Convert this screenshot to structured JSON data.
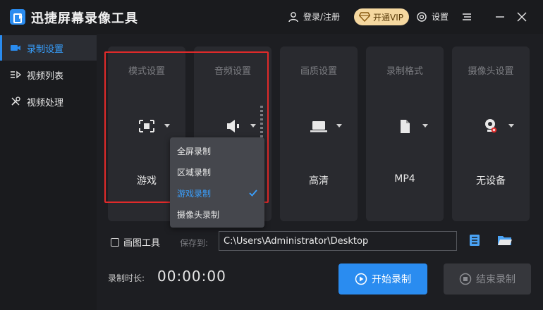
{
  "app": {
    "title": "迅捷屏幕录像工具"
  },
  "header": {
    "login_label": "登录/注册",
    "vip_label": "开通VIP",
    "settings_label": "设置"
  },
  "sidebar": {
    "items": [
      {
        "label": "录制设置",
        "icon": "record-settings-icon",
        "active": true
      },
      {
        "label": "视频列表",
        "icon": "video-list-icon",
        "active": false
      },
      {
        "label": "视频处理",
        "icon": "video-process-icon",
        "active": false
      }
    ]
  },
  "cards": [
    {
      "title": "模式设置",
      "value": "游戏",
      "icon": "screen-mode-icon"
    },
    {
      "title": "音频设置",
      "value": "",
      "icon": "speaker-icon"
    },
    {
      "title": "画质设置",
      "value": "高清",
      "icon": "laptop-icon"
    },
    {
      "title": "录制格式",
      "value": "MP4",
      "icon": "file-icon"
    },
    {
      "title": "摄像头设置",
      "value": "无设备",
      "icon": "webcam-disabled-icon"
    }
  ],
  "mode_dropdown": {
    "options": [
      "全屏录制",
      "区域录制",
      "游戏录制",
      "摄像头录制"
    ],
    "selected": "游戏录制"
  },
  "bottom": {
    "draw_tool_label": "画图工具",
    "draw_tool_checked": false,
    "save_to_label": "保存到:",
    "save_path": "C:\\Users\\Administrator\\Desktop",
    "duration_label": "录制时长:",
    "duration_value": "00:00:00",
    "start_label": "开始录制",
    "stop_label": "结束录制"
  },
  "colors": {
    "accent": "#2a8cf0",
    "highlight_box": "#e02a2a",
    "vip_bg": "#f5d8a0"
  }
}
